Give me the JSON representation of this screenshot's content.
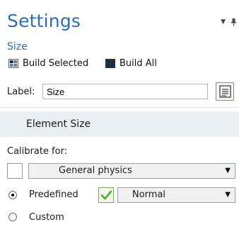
{
  "header": {
    "title": "Settings",
    "subtitle": "Size"
  },
  "toolbar": {
    "build_selected_label": "Build Selected",
    "build_all_label": "Build All"
  },
  "label_field": {
    "label": "Label:",
    "value": "Size"
  },
  "section": {
    "title": "Element Size"
  },
  "calibrate": {
    "label": "Calibrate for:",
    "selected": "General physics"
  },
  "size_mode": {
    "predefined_label": "Predefined",
    "custom_label": "Custom",
    "selected": "Predefined",
    "predefined_value": "Normal",
    "predefined_checked": true
  },
  "colors": {
    "accent": "#2e6db4",
    "section_bg": "#e9eef4",
    "check_green": "#4caf20"
  },
  "icons": [
    "dropdown-arrow-icon",
    "pin-icon",
    "build-selected-icon",
    "build-all-icon",
    "form-icon",
    "checkmark-icon"
  ]
}
